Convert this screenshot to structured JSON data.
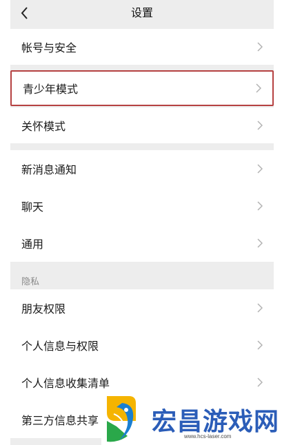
{
  "header": {
    "title": "设置",
    "back_icon": "chevron-left-icon"
  },
  "groups": {
    "account": {
      "label": "帐号与安全"
    },
    "youth": {
      "label": "青少年模式"
    },
    "care": {
      "label": "关怀模式"
    },
    "notifications": {
      "label": "新消息通知"
    },
    "chat": {
      "label": "聊天"
    },
    "general": {
      "label": "通用"
    }
  },
  "privacy": {
    "section_label": "隐私",
    "friend_permissions": "朋友权限",
    "personal_info_permissions": "个人信息与权限",
    "personal_info_list": "个人信息收集清单",
    "third_party_sharing": "第三方信息共享"
  },
  "watermark": {
    "brand": "宏昌游戏网",
    "url": "www.hcs-laser.com"
  },
  "colors": {
    "background": "#ededed",
    "row": "#ffffff",
    "highlight_border": "#b54040",
    "watermark_text": "#2b5db8"
  },
  "icons": {
    "row_chevron": "chevron-right-icon"
  }
}
